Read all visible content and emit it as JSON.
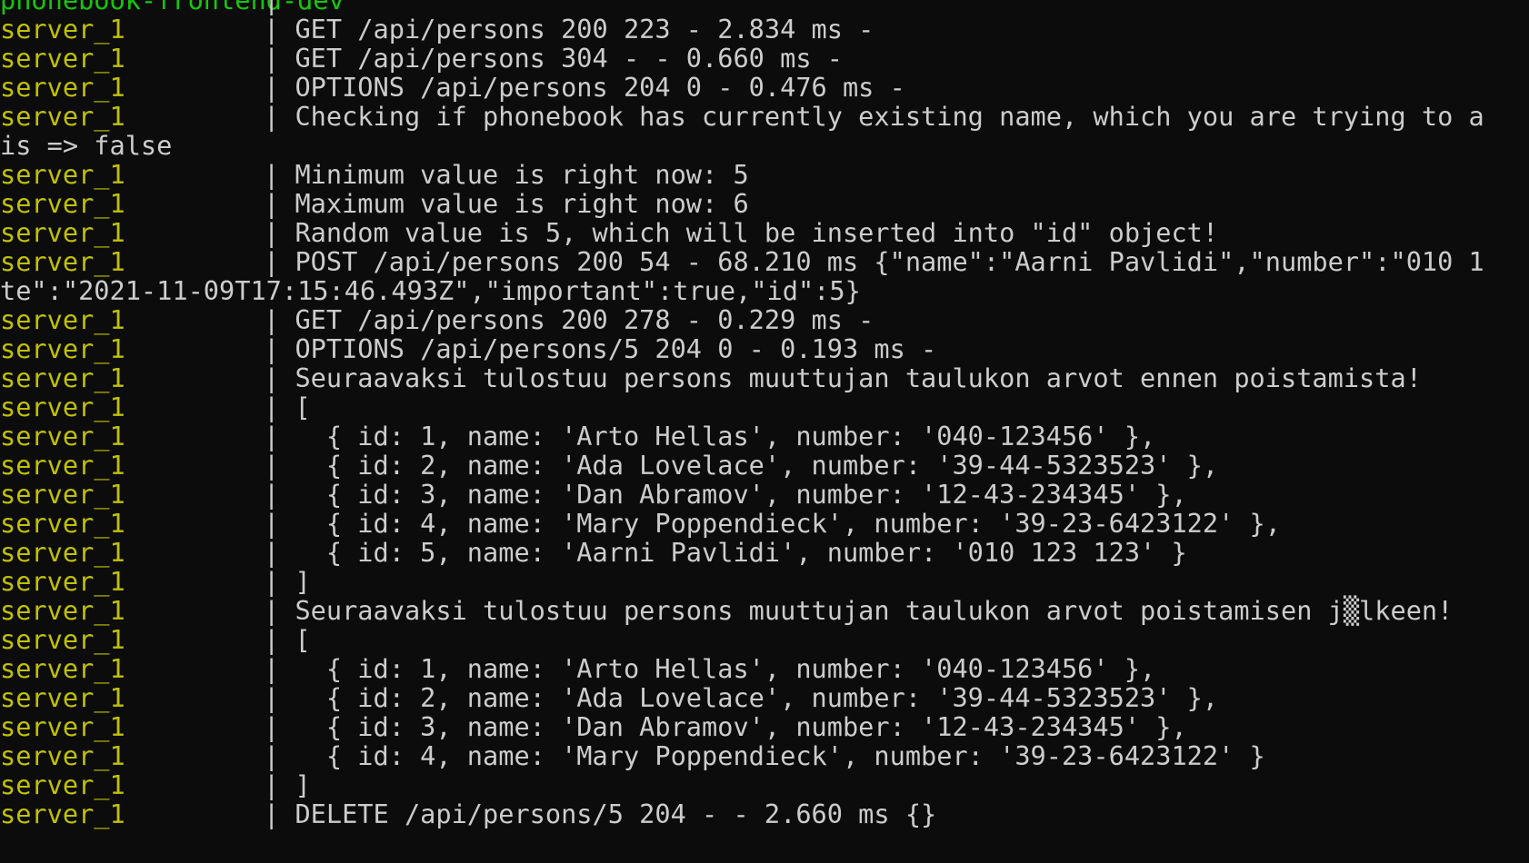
{
  "terminal": {
    "colors": {
      "background": "#0c0c0c",
      "frontend_prefix": "#16c60c",
      "server_prefix": "#c1c100",
      "text": "#cccccc"
    },
    "lines": [
      {
        "type": "prefix",
        "service": "phonebook-frontend-dev",
        "service_class": "svc-frontend",
        "sep": "|",
        "text": ""
      },
      {
        "type": "prefix",
        "service": "server_1",
        "service_class": "svc-server",
        "sep": "|",
        "text": "GET /api/persons 200 223 - 2.834 ms -"
      },
      {
        "type": "prefix",
        "service": "server_1",
        "service_class": "svc-server",
        "sep": "|",
        "text": "GET /api/persons 304 - - 0.660 ms -"
      },
      {
        "type": "prefix",
        "service": "server_1",
        "service_class": "svc-server",
        "sep": "|",
        "text": "OPTIONS /api/persons 204 0 - 0.476 ms -"
      },
      {
        "type": "prefix",
        "service": "server_1",
        "service_class": "svc-server",
        "sep": "|",
        "text": "Checking if phonebook has currently existing name, which you are trying to a"
      },
      {
        "type": "cont",
        "text": "is => false"
      },
      {
        "type": "prefix",
        "service": "server_1",
        "service_class": "svc-server",
        "sep": "|",
        "text": "Minimum value is right now: 5"
      },
      {
        "type": "prefix",
        "service": "server_1",
        "service_class": "svc-server",
        "sep": "|",
        "text": "Maximum value is right now: 6"
      },
      {
        "type": "prefix",
        "service": "server_1",
        "service_class": "svc-server",
        "sep": "|",
        "text": "Random value is 5, which will be inserted into \"id\" object!"
      },
      {
        "type": "prefix",
        "service": "server_1",
        "service_class": "svc-server",
        "sep": "|",
        "text": "POST /api/persons 200 54 - 68.210 ms {\"name\":\"Aarni Pavlidi\",\"number\":\"010 1"
      },
      {
        "type": "cont",
        "text": "te\":\"2021-11-09T17:15:46.493Z\",\"important\":true,\"id\":5}"
      },
      {
        "type": "prefix",
        "service": "server_1",
        "service_class": "svc-server",
        "sep": "|",
        "text": "GET /api/persons 200 278 - 0.229 ms -"
      },
      {
        "type": "prefix",
        "service": "server_1",
        "service_class": "svc-server",
        "sep": "|",
        "text": "OPTIONS /api/persons/5 204 0 - 0.193 ms -"
      },
      {
        "type": "prefix",
        "service": "server_1",
        "service_class": "svc-server",
        "sep": "|",
        "text": "Seuraavaksi tulostuu persons muuttujan taulukon arvot ennen poistamista!"
      },
      {
        "type": "prefix",
        "service": "server_1",
        "service_class": "svc-server",
        "sep": "|",
        "text": "["
      },
      {
        "type": "prefix",
        "service": "server_1",
        "service_class": "svc-server",
        "sep": "|",
        "text": "  { id: 1, name: 'Arto Hellas', number: '040-123456' },"
      },
      {
        "type": "prefix",
        "service": "server_1",
        "service_class": "svc-server",
        "sep": "|",
        "text": "  { id: 2, name: 'Ada Lovelace', number: '39-44-5323523' },"
      },
      {
        "type": "prefix",
        "service": "server_1",
        "service_class": "svc-server",
        "sep": "|",
        "text": "  { id: 3, name: 'Dan Abramov', number: '12-43-234345' },"
      },
      {
        "type": "prefix",
        "service": "server_1",
        "service_class": "svc-server",
        "sep": "|",
        "text": "  { id: 4, name: 'Mary Poppendieck', number: '39-23-6423122' },"
      },
      {
        "type": "prefix",
        "service": "server_1",
        "service_class": "svc-server",
        "sep": "|",
        "text": "  { id: 5, name: 'Aarni Pavlidi', number: '010 123 123' }"
      },
      {
        "type": "prefix",
        "service": "server_1",
        "service_class": "svc-server",
        "sep": "|",
        "text": "]"
      },
      {
        "type": "prefix",
        "service": "server_1",
        "service_class": "svc-server",
        "sep": "|",
        "text": "Seuraavaksi tulostuu persons muuttujan taulukon arvot poistamisen j▒lkeen!"
      },
      {
        "type": "prefix",
        "service": "server_1",
        "service_class": "svc-server",
        "sep": "|",
        "text": "["
      },
      {
        "type": "prefix",
        "service": "server_1",
        "service_class": "svc-server",
        "sep": "|",
        "text": "  { id: 1, name: 'Arto Hellas', number: '040-123456' },"
      },
      {
        "type": "prefix",
        "service": "server_1",
        "service_class": "svc-server",
        "sep": "|",
        "text": "  { id: 2, name: 'Ada Lovelace', number: '39-44-5323523' },"
      },
      {
        "type": "prefix",
        "service": "server_1",
        "service_class": "svc-server",
        "sep": "|",
        "text": "  { id: 3, name: 'Dan Abramov', number: '12-43-234345' },"
      },
      {
        "type": "prefix",
        "service": "server_1",
        "service_class": "svc-server",
        "sep": "|",
        "text": "  { id: 4, name: 'Mary Poppendieck', number: '39-23-6423122' }"
      },
      {
        "type": "prefix",
        "service": "server_1",
        "service_class": "svc-server",
        "sep": "|",
        "text": "]"
      },
      {
        "type": "prefix",
        "service": "server_1",
        "service_class": "svc-server",
        "sep": "|",
        "text": "DELETE /api/persons/5 204 - - 2.660 ms {}"
      }
    ]
  }
}
